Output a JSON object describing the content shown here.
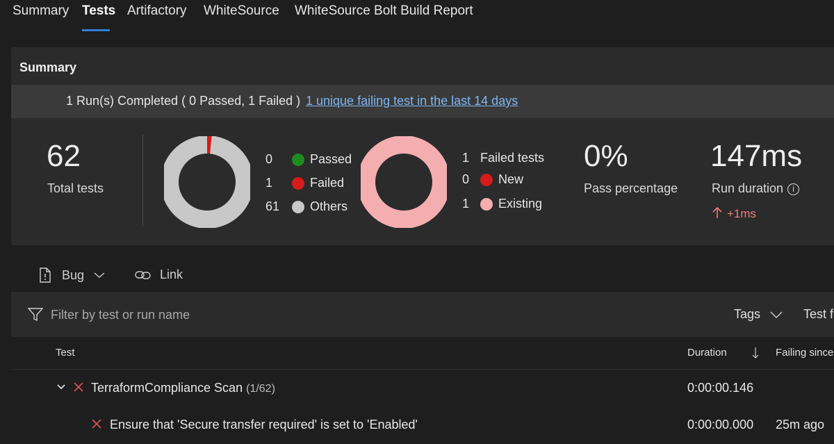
{
  "tabs": [
    {
      "label": "Summary"
    },
    {
      "label": "Tests"
    },
    {
      "label": "Artifactory"
    },
    {
      "label": "WhiteSource"
    },
    {
      "label": "WhiteSource Bolt Build Report"
    }
  ],
  "summary": {
    "title": "Summary",
    "run_text": "1 Run(s) Completed ( 0 Passed, 1 Failed )",
    "run_link": "1 unique failing test in the last 14 days",
    "total_tests": "62",
    "total_tests_label": "Total tests",
    "outcome_legend": [
      {
        "count": "0",
        "label": "Passed",
        "color": "#1e8b1e"
      },
      {
        "count": "1",
        "label": "Failed",
        "color": "#d41c1c"
      },
      {
        "count": "61",
        "label": "Others",
        "color": "#c8c8c8"
      }
    ],
    "failed_legend": {
      "count": "1",
      "label": "Failed tests",
      "items": [
        {
          "count": "0",
          "label": "New",
          "color": "#d41c1c"
        },
        {
          "count": "1",
          "label": "Existing",
          "color": "#f4aeb0"
        }
      ]
    },
    "pass_percentage": "0%",
    "pass_percentage_label": "Pass percentage",
    "run_duration": "147ms",
    "run_duration_label": "Run duration",
    "run_duration_delta": "+1ms",
    "donut_outcomes": {
      "passed": 0,
      "failed": 1,
      "others": 61
    },
    "donut_failed": {
      "new": 0,
      "existing": 1
    }
  },
  "toolbar": {
    "bug_label": "Bug",
    "link_label": "Link"
  },
  "filter": {
    "placeholder": "Filter by test or run name",
    "tags_label": "Tags",
    "test_filter_label": "Test f"
  },
  "table": {
    "headers": {
      "test": "Test",
      "duration": "Duration",
      "failing_since": "Failing since"
    },
    "group_row": {
      "name": "TerraformCompliance Scan",
      "count": "(1/62)",
      "duration": "0:00:00.146"
    },
    "test_row": {
      "name": "Ensure that 'Secure transfer required' is set to 'Enabled'",
      "duration": "0:00:00.000",
      "failing_since": "25m ago"
    }
  },
  "colors": {
    "accent": "#2f7fd6",
    "link": "#7fb5f0",
    "failed": "#d41c1c",
    "existing": "#f4aeb0",
    "delta_red": "#f27b7b"
  }
}
